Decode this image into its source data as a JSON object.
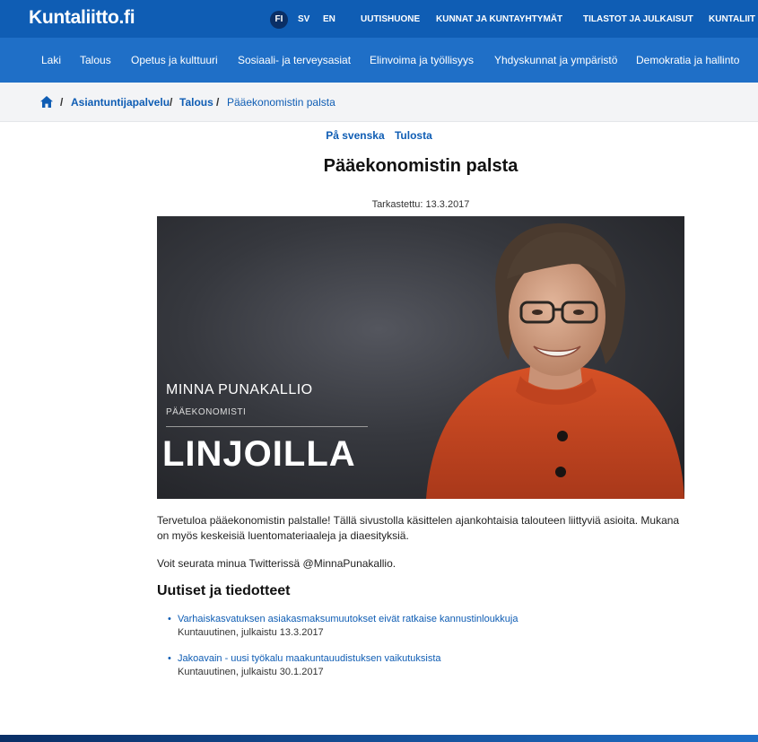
{
  "header": {
    "logo": "Kuntaliitto.fi",
    "languages": [
      "FI",
      "SV",
      "EN"
    ],
    "top_links": [
      "UUTISHUONE",
      "KUNNAT JA KUNTAYHTYMÄT",
      "TILASTOT JA JULKAISUT",
      "KUNTALIIT"
    ]
  },
  "nav": {
    "items": [
      "Laki",
      "Talous",
      "Opetus ja kulttuuri",
      "Sosiaali- ja terveysasiat",
      "Elinvoima ja työllisyys",
      "Yhdyskunnat ja ympäristö",
      "Demokratia ja hallinto"
    ]
  },
  "breadcrumb": {
    "items": [
      "Asiantuntijapalvelu",
      "Talous"
    ],
    "current": "Pääekonomistin palsta",
    "separator": "/"
  },
  "page": {
    "actions": [
      "På svenska",
      "Tulosta"
    ],
    "title": "Pääekonomistin palsta",
    "checked_label": "Tarkastettu:",
    "checked_date": "13.3.2017",
    "hero": {
      "name": "MINNA PUNAKALLIO",
      "role": "PÄÄEKONOMISTI",
      "headline": "LINJOILLA"
    },
    "intro": "Tervetuloa pääekonomistin palstalle! Tällä sivustolla käsittelen ajankohtaisia talouteen liittyviä asioita. Mukana on myös keskeisiä luentomateriaaleja ja diaesityksiä.",
    "twitter": "Voit seurata minua Twitterissä @MinnaPunakallio.",
    "news_heading": "Uutiset ja tiedotteet",
    "news": [
      {
        "title": "Varhaiskasvatuksen asiakasmaksumuutokset eivät ratkaise kannustinloukkuja",
        "meta": "Kuntauutinen, julkaistu 13.3.2017"
      },
      {
        "title": "Jakoavain - uusi työkalu maakuntauudistuksen vaikutuksista",
        "meta": "Kuntauutinen, julkaistu 30.1.2017"
      }
    ]
  },
  "colors": {
    "brand_blue": "#0f5db4",
    "nav_blue": "#1f6fc7",
    "dark_blue": "#0a2f66",
    "sweater_orange": "#c8441e"
  }
}
